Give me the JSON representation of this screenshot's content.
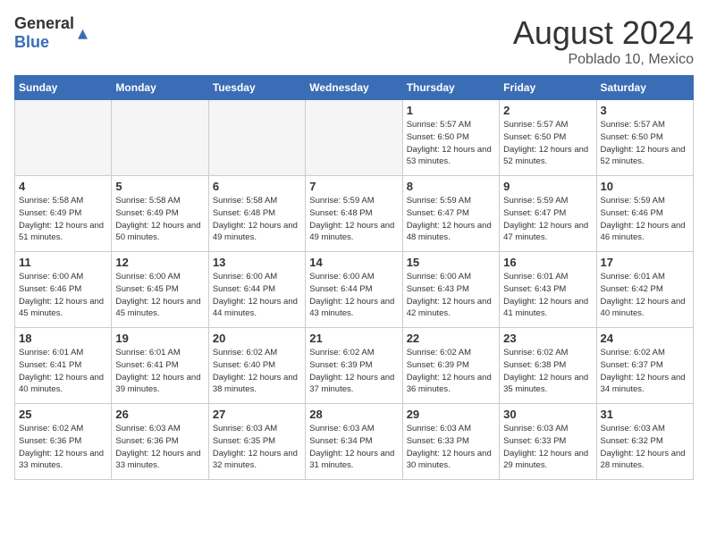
{
  "header": {
    "logo_general": "General",
    "logo_blue": "Blue",
    "month_year": "August 2024",
    "location": "Poblado 10, Mexico"
  },
  "days_of_week": [
    "Sunday",
    "Monday",
    "Tuesday",
    "Wednesday",
    "Thursday",
    "Friday",
    "Saturday"
  ],
  "weeks": [
    [
      {
        "day": "",
        "empty": true
      },
      {
        "day": "",
        "empty": true
      },
      {
        "day": "",
        "empty": true
      },
      {
        "day": "",
        "empty": true
      },
      {
        "day": "1",
        "sunrise": "5:57 AM",
        "sunset": "6:50 PM",
        "daylight": "12 hours and 53 minutes."
      },
      {
        "day": "2",
        "sunrise": "5:57 AM",
        "sunset": "6:50 PM",
        "daylight": "12 hours and 52 minutes."
      },
      {
        "day": "3",
        "sunrise": "5:57 AM",
        "sunset": "6:50 PM",
        "daylight": "12 hours and 52 minutes."
      }
    ],
    [
      {
        "day": "4",
        "sunrise": "5:58 AM",
        "sunset": "6:49 PM",
        "daylight": "12 hours and 51 minutes."
      },
      {
        "day": "5",
        "sunrise": "5:58 AM",
        "sunset": "6:49 PM",
        "daylight": "12 hours and 50 minutes."
      },
      {
        "day": "6",
        "sunrise": "5:58 AM",
        "sunset": "6:48 PM",
        "daylight": "12 hours and 49 minutes."
      },
      {
        "day": "7",
        "sunrise": "5:59 AM",
        "sunset": "6:48 PM",
        "daylight": "12 hours and 49 minutes."
      },
      {
        "day": "8",
        "sunrise": "5:59 AM",
        "sunset": "6:47 PM",
        "daylight": "12 hours and 48 minutes."
      },
      {
        "day": "9",
        "sunrise": "5:59 AM",
        "sunset": "6:47 PM",
        "daylight": "12 hours and 47 minutes."
      },
      {
        "day": "10",
        "sunrise": "5:59 AM",
        "sunset": "6:46 PM",
        "daylight": "12 hours and 46 minutes."
      }
    ],
    [
      {
        "day": "11",
        "sunrise": "6:00 AM",
        "sunset": "6:46 PM",
        "daylight": "12 hours and 45 minutes."
      },
      {
        "day": "12",
        "sunrise": "6:00 AM",
        "sunset": "6:45 PM",
        "daylight": "12 hours and 45 minutes."
      },
      {
        "day": "13",
        "sunrise": "6:00 AM",
        "sunset": "6:44 PM",
        "daylight": "12 hours and 44 minutes."
      },
      {
        "day": "14",
        "sunrise": "6:00 AM",
        "sunset": "6:44 PM",
        "daylight": "12 hours and 43 minutes."
      },
      {
        "day": "15",
        "sunrise": "6:00 AM",
        "sunset": "6:43 PM",
        "daylight": "12 hours and 42 minutes."
      },
      {
        "day": "16",
        "sunrise": "6:01 AM",
        "sunset": "6:43 PM",
        "daylight": "12 hours and 41 minutes."
      },
      {
        "day": "17",
        "sunrise": "6:01 AM",
        "sunset": "6:42 PM",
        "daylight": "12 hours and 40 minutes."
      }
    ],
    [
      {
        "day": "18",
        "sunrise": "6:01 AM",
        "sunset": "6:41 PM",
        "daylight": "12 hours and 40 minutes."
      },
      {
        "day": "19",
        "sunrise": "6:01 AM",
        "sunset": "6:41 PM",
        "daylight": "12 hours and 39 minutes."
      },
      {
        "day": "20",
        "sunrise": "6:02 AM",
        "sunset": "6:40 PM",
        "daylight": "12 hours and 38 minutes."
      },
      {
        "day": "21",
        "sunrise": "6:02 AM",
        "sunset": "6:39 PM",
        "daylight": "12 hours and 37 minutes."
      },
      {
        "day": "22",
        "sunrise": "6:02 AM",
        "sunset": "6:39 PM",
        "daylight": "12 hours and 36 minutes."
      },
      {
        "day": "23",
        "sunrise": "6:02 AM",
        "sunset": "6:38 PM",
        "daylight": "12 hours and 35 minutes."
      },
      {
        "day": "24",
        "sunrise": "6:02 AM",
        "sunset": "6:37 PM",
        "daylight": "12 hours and 34 minutes."
      }
    ],
    [
      {
        "day": "25",
        "sunrise": "6:02 AM",
        "sunset": "6:36 PM",
        "daylight": "12 hours and 33 minutes."
      },
      {
        "day": "26",
        "sunrise": "6:03 AM",
        "sunset": "6:36 PM",
        "daylight": "12 hours and 33 minutes."
      },
      {
        "day": "27",
        "sunrise": "6:03 AM",
        "sunset": "6:35 PM",
        "daylight": "12 hours and 32 minutes."
      },
      {
        "day": "28",
        "sunrise": "6:03 AM",
        "sunset": "6:34 PM",
        "daylight": "12 hours and 31 minutes."
      },
      {
        "day": "29",
        "sunrise": "6:03 AM",
        "sunset": "6:33 PM",
        "daylight": "12 hours and 30 minutes."
      },
      {
        "day": "30",
        "sunrise": "6:03 AM",
        "sunset": "6:33 PM",
        "daylight": "12 hours and 29 minutes."
      },
      {
        "day": "31",
        "sunrise": "6:03 AM",
        "sunset": "6:32 PM",
        "daylight": "12 hours and 28 minutes."
      }
    ]
  ]
}
